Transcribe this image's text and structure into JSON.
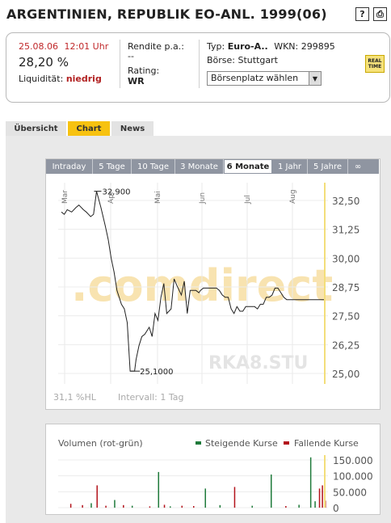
{
  "header": {
    "title": "ARGENTINIEN, REPUBLIK EO-ANL. 1999(06)",
    "help_label": "?",
    "print_label": "⎙"
  },
  "quote": {
    "date": "25.08.06",
    "time": "12:01 Uhr",
    "price": "28,20 %",
    "liquidity_label": "Liquidität:",
    "liquidity_value": "niedrig",
    "yield_label": "Rendite p.a.:",
    "yield_value": "--",
    "rating_label": "Rating:",
    "rating_value": "WR",
    "type_label": "Typ:",
    "type_value": "Euro-A..",
    "wkn_label": "WKN:",
    "wkn_value": "299895",
    "exchange_label": "Börse:",
    "exchange_value": "Stuttgart",
    "exchange_select": "Börsenplatz wählen",
    "realtime_icon": "REAL TIME"
  },
  "tabs": [
    {
      "label": "Übersicht",
      "active": false
    },
    {
      "label": "Chart",
      "active": true
    },
    {
      "label": "News",
      "active": false
    }
  ],
  "range_tabs": [
    {
      "label": "Intraday",
      "active": false
    },
    {
      "label": "5 Tage",
      "active": false
    },
    {
      "label": "10 Tage",
      "active": false
    },
    {
      "label": "3 Monate",
      "active": false
    },
    {
      "label": "6 Monate",
      "active": true
    },
    {
      "label": "1 Jahr",
      "active": false
    },
    {
      "label": "5 Jahre",
      "active": false
    },
    {
      "label": "∞",
      "active": false
    }
  ],
  "chart_data": {
    "type": "line",
    "watermark": ".comdirect",
    "symbol_watermark": "RKA8.STU",
    "months": [
      "Mar",
      "Apr",
      "Mai",
      "Jun",
      "Jul",
      "Aug"
    ],
    "y_ticks": [
      "32,50",
      "31,25",
      "30,00",
      "28,75",
      "27,50",
      "26,25",
      "25,00"
    ],
    "ylim": [
      25.0,
      32.5
    ],
    "max_label": "32,900",
    "min_label": "25,1000",
    "footer_left": "31,1 %HL",
    "footer_right": "Intervall: 1 Tag",
    "x": [
      0,
      2,
      4,
      7,
      10,
      12,
      15,
      17,
      20,
      22,
      24,
      27,
      30,
      32,
      34,
      36,
      38,
      41,
      43,
      45,
      47,
      49,
      50,
      51,
      53,
      55,
      57,
      60,
      62,
      64,
      66,
      68,
      70,
      72,
      75,
      77,
      79,
      82,
      84,
      86,
      88,
      90,
      92,
      94,
      95,
      97,
      99,
      101,
      103,
      106,
      108,
      110,
      112,
      114,
      116,
      118,
      120,
      122,
      124,
      126,
      128,
      130,
      132,
      134,
      136,
      138,
      140,
      142,
      144,
      146,
      148,
      150,
      152,
      154,
      156,
      158,
      160,
      162,
      164,
      166,
      168,
      170,
      172,
      174,
      176,
      178,
      180
    ],
    "values": [
      32.0,
      31.9,
      32.1,
      32.0,
      32.2,
      32.3,
      32.1,
      32.0,
      31.8,
      31.9,
      32.9,
      32.2,
      31.4,
      30.8,
      30.0,
      29.4,
      28.6,
      28.0,
      27.8,
      27.2,
      25.1,
      25.1,
      25.1,
      25.6,
      26.2,
      26.6,
      26.7,
      27.0,
      26.6,
      27.6,
      27.3,
      28.3,
      28.9,
      27.6,
      27.8,
      29.1,
      28.8,
      28.4,
      29.0,
      27.6,
      28.6,
      28.6,
      28.6,
      28.5,
      28.6,
      28.7,
      28.7,
      28.7,
      28.7,
      28.7,
      28.6,
      28.4,
      28.3,
      28.3,
      27.8,
      27.6,
      27.9,
      27.7,
      27.7,
      27.9,
      27.9,
      27.9,
      27.9,
      27.8,
      28.0,
      28.0,
      28.3,
      28.3,
      28.4,
      28.7,
      28.7,
      28.5,
      28.3,
      28.2,
      28.2,
      28.2,
      28.2,
      28.2,
      28.2,
      28.2,
      28.2,
      28.2,
      28.2,
      28.2,
      28.2,
      28.2,
      28.2
    ]
  },
  "volume_chart": {
    "title": "Volumen (rot-grün)",
    "legend_up": "Steigende Kurse",
    "legend_down": "Fallende Kurse",
    "up_color": "#1e7a3a",
    "down_color": "#b3131b",
    "y_ticks": [
      "150.000",
      "100.000",
      "50.000",
      "0"
    ],
    "ylim": [
      0,
      160000
    ],
    "bars": [
      {
        "x": 6,
        "v": 12000,
        "dir": "down"
      },
      {
        "x": 14,
        "v": 8000,
        "dir": "down"
      },
      {
        "x": 20,
        "v": 14000,
        "dir": "up"
      },
      {
        "x": 24,
        "v": 70000,
        "dir": "down"
      },
      {
        "x": 30,
        "v": 6000,
        "dir": "down"
      },
      {
        "x": 36,
        "v": 24000,
        "dir": "up"
      },
      {
        "x": 42,
        "v": 8000,
        "dir": "down"
      },
      {
        "x": 48,
        "v": 6000,
        "dir": "up"
      },
      {
        "x": 60,
        "v": 4000,
        "dir": "down"
      },
      {
        "x": 66,
        "v": 112000,
        "dir": "up"
      },
      {
        "x": 70,
        "v": 9000,
        "dir": "down"
      },
      {
        "x": 74,
        "v": 4000,
        "dir": "up"
      },
      {
        "x": 82,
        "v": 6000,
        "dir": "down"
      },
      {
        "x": 90,
        "v": 5000,
        "dir": "down"
      },
      {
        "x": 98,
        "v": 60000,
        "dir": "up"
      },
      {
        "x": 108,
        "v": 8000,
        "dir": "up"
      },
      {
        "x": 118,
        "v": 65000,
        "dir": "down"
      },
      {
        "x": 130,
        "v": 6000,
        "dir": "up"
      },
      {
        "x": 143,
        "v": 104000,
        "dir": "up"
      },
      {
        "x": 153,
        "v": 5000,
        "dir": "down"
      },
      {
        "x": 162,
        "v": 9000,
        "dir": "up"
      },
      {
        "x": 170,
        "v": 158000,
        "dir": "up"
      },
      {
        "x": 173,
        "v": 20000,
        "dir": "up"
      },
      {
        "x": 176,
        "v": 60000,
        "dir": "down"
      },
      {
        "x": 178,
        "v": 70000,
        "dir": "down"
      },
      {
        "x": 180,
        "v": 22000,
        "dir": "down"
      }
    ]
  }
}
